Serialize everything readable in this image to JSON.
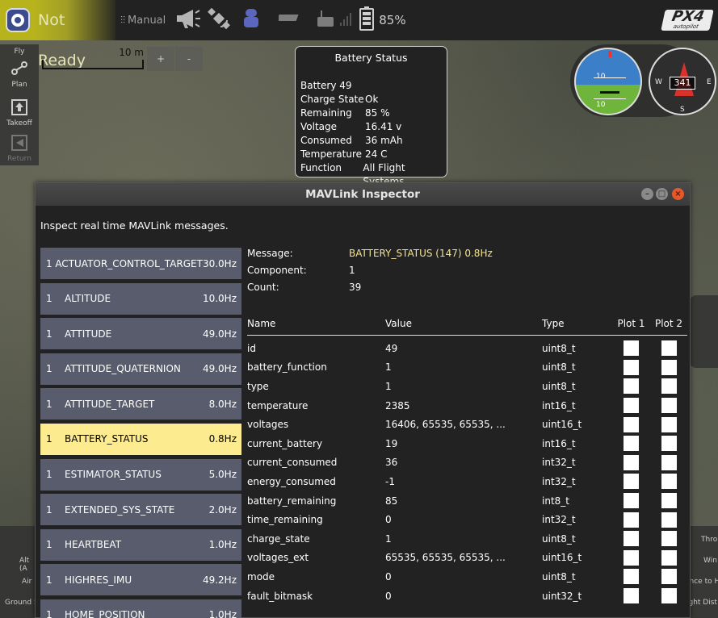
{
  "toolbar": {
    "status": "Not Ready",
    "flight_mode": "Manual",
    "battery_percent": "85%",
    "brand": "PX4",
    "brand_sub": "autopilot"
  },
  "nav": [
    {
      "label": "Fly",
      "icon": "fly-icon"
    },
    {
      "label": "Plan",
      "icon": "plan-icon"
    },
    {
      "label": "Takeoff",
      "icon": "takeoff-icon"
    },
    {
      "label": "Return",
      "icon": "return-icon"
    }
  ],
  "map": {
    "scale_label": "10 m",
    "zoom_in": "+",
    "zoom_out": "-"
  },
  "battery_popup": {
    "title": "Battery Status",
    "id_label": "Battery 49",
    "rows": [
      {
        "k": "Charge State",
        "v": "Ok"
      },
      {
        "k": "Remaining",
        "v": "85 %"
      },
      {
        "k": "Voltage",
        "v": "16.41 v"
      },
      {
        "k": "Consumed",
        "v": "36 mAh"
      },
      {
        "k": "Temperature",
        "v": "24 C"
      },
      {
        "k": "Function",
        "v": "All Flight Systems"
      }
    ]
  },
  "instruments": {
    "heading": "341",
    "pitch_labels": [
      "10",
      "10"
    ],
    "compass_cardinals": {
      "w": "W",
      "e": "E",
      "s": "S"
    }
  },
  "telemetry_fragments": {
    "left": [
      "Alt (A",
      "Air S",
      "Ground S"
    ],
    "right": [
      "Thro",
      "Win",
      "ance to H",
      "ight Dist"
    ]
  },
  "dialog": {
    "title": "MAVLink Inspector",
    "description": "Inspect real time MAVLink messages.",
    "messages": [
      {
        "cid": "1",
        "name": "ACTUATOR_CONTROL_TARGET",
        "hz": "30.0Hz"
      },
      {
        "cid": "1",
        "name": "ALTITUDE",
        "hz": "10.0Hz"
      },
      {
        "cid": "1",
        "name": "ATTITUDE",
        "hz": "49.0Hz"
      },
      {
        "cid": "1",
        "name": "ATTITUDE_QUATERNION",
        "hz": "49.0Hz"
      },
      {
        "cid": "1",
        "name": "ATTITUDE_TARGET",
        "hz": "8.0Hz"
      },
      {
        "cid": "1",
        "name": "BATTERY_STATUS",
        "hz": "0.8Hz",
        "selected": true
      },
      {
        "cid": "1",
        "name": "ESTIMATOR_STATUS",
        "hz": "5.0Hz"
      },
      {
        "cid": "1",
        "name": "EXTENDED_SYS_STATE",
        "hz": "2.0Hz"
      },
      {
        "cid": "1",
        "name": "HEARTBEAT",
        "hz": "1.0Hz"
      },
      {
        "cid": "1",
        "name": "HIGHRES_IMU",
        "hz": "49.2Hz"
      },
      {
        "cid": "1",
        "name": "HOME_POSITION",
        "hz": "1.0Hz"
      }
    ],
    "meta": {
      "message_label": "Message:",
      "message_value": "BATTERY_STATUS (147) 0.8Hz",
      "component_label": "Component:",
      "component_value": "1",
      "count_label": "Count:",
      "count_value": "39"
    },
    "table_headers": {
      "name": "Name",
      "value": "Value",
      "type": "Type",
      "plot1": "Plot 1",
      "plot2": "Plot 2"
    },
    "fields": [
      {
        "name": "id",
        "value": "49",
        "type": "uint8_t"
      },
      {
        "name": "battery_function",
        "value": "1",
        "type": "uint8_t"
      },
      {
        "name": "type",
        "value": "1",
        "type": "uint8_t"
      },
      {
        "name": "temperature",
        "value": "2385",
        "type": "int16_t"
      },
      {
        "name": "voltages",
        "value": "16406, 65535, 65535, ...",
        "type": "uint16_t"
      },
      {
        "name": "current_battery",
        "value": "19",
        "type": "int16_t"
      },
      {
        "name": "current_consumed",
        "value": "36",
        "type": "int32_t"
      },
      {
        "name": "energy_consumed",
        "value": "-1",
        "type": "int32_t"
      },
      {
        "name": "battery_remaining",
        "value": "85",
        "type": "int8_t"
      },
      {
        "name": "time_remaining",
        "value": "0",
        "type": "int32_t"
      },
      {
        "name": "charge_state",
        "value": "1",
        "type": "uint8_t"
      },
      {
        "name": "voltages_ext",
        "value": "65535, 65535, 65535, ...",
        "type": "uint16_t"
      },
      {
        "name": "mode",
        "value": "0",
        "type": "uint8_t"
      },
      {
        "name": "fault_bitmask",
        "value": "0",
        "type": "uint32_t"
      }
    ]
  }
}
